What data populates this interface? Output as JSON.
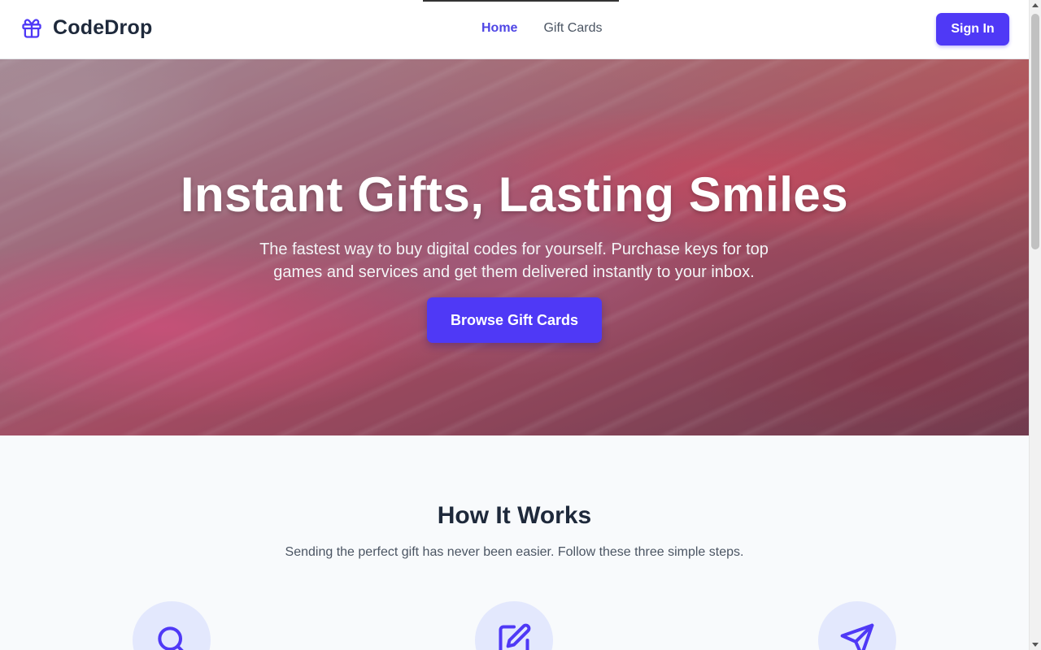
{
  "header": {
    "logo_text": "CodeDrop",
    "logo_icon": "gift-icon",
    "nav": [
      {
        "label": "Home",
        "active": true
      },
      {
        "label": "Gift Cards",
        "active": false
      }
    ],
    "signin_label": "Sign In"
  },
  "hero": {
    "title": "Instant Gifts, Lasting Smiles",
    "subtitle": "The fastest way to buy digital codes for yourself. Purchase keys for top games and services and get them delivered instantly to your inbox.",
    "cta_label": "Browse Gift Cards"
  },
  "how_it_works": {
    "title": "How It Works",
    "subtitle": "Sending the perfect gift has never been easier. Follow these three simple steps.",
    "steps": [
      {
        "icon": "search-icon"
      },
      {
        "icon": "edit-icon"
      },
      {
        "icon": "send-icon"
      }
    ]
  },
  "colors": {
    "brand": "#4f39f6",
    "nav_active": "#4f46e5",
    "icon_circle": "#e3e8fd",
    "heading": "#1e293b"
  }
}
